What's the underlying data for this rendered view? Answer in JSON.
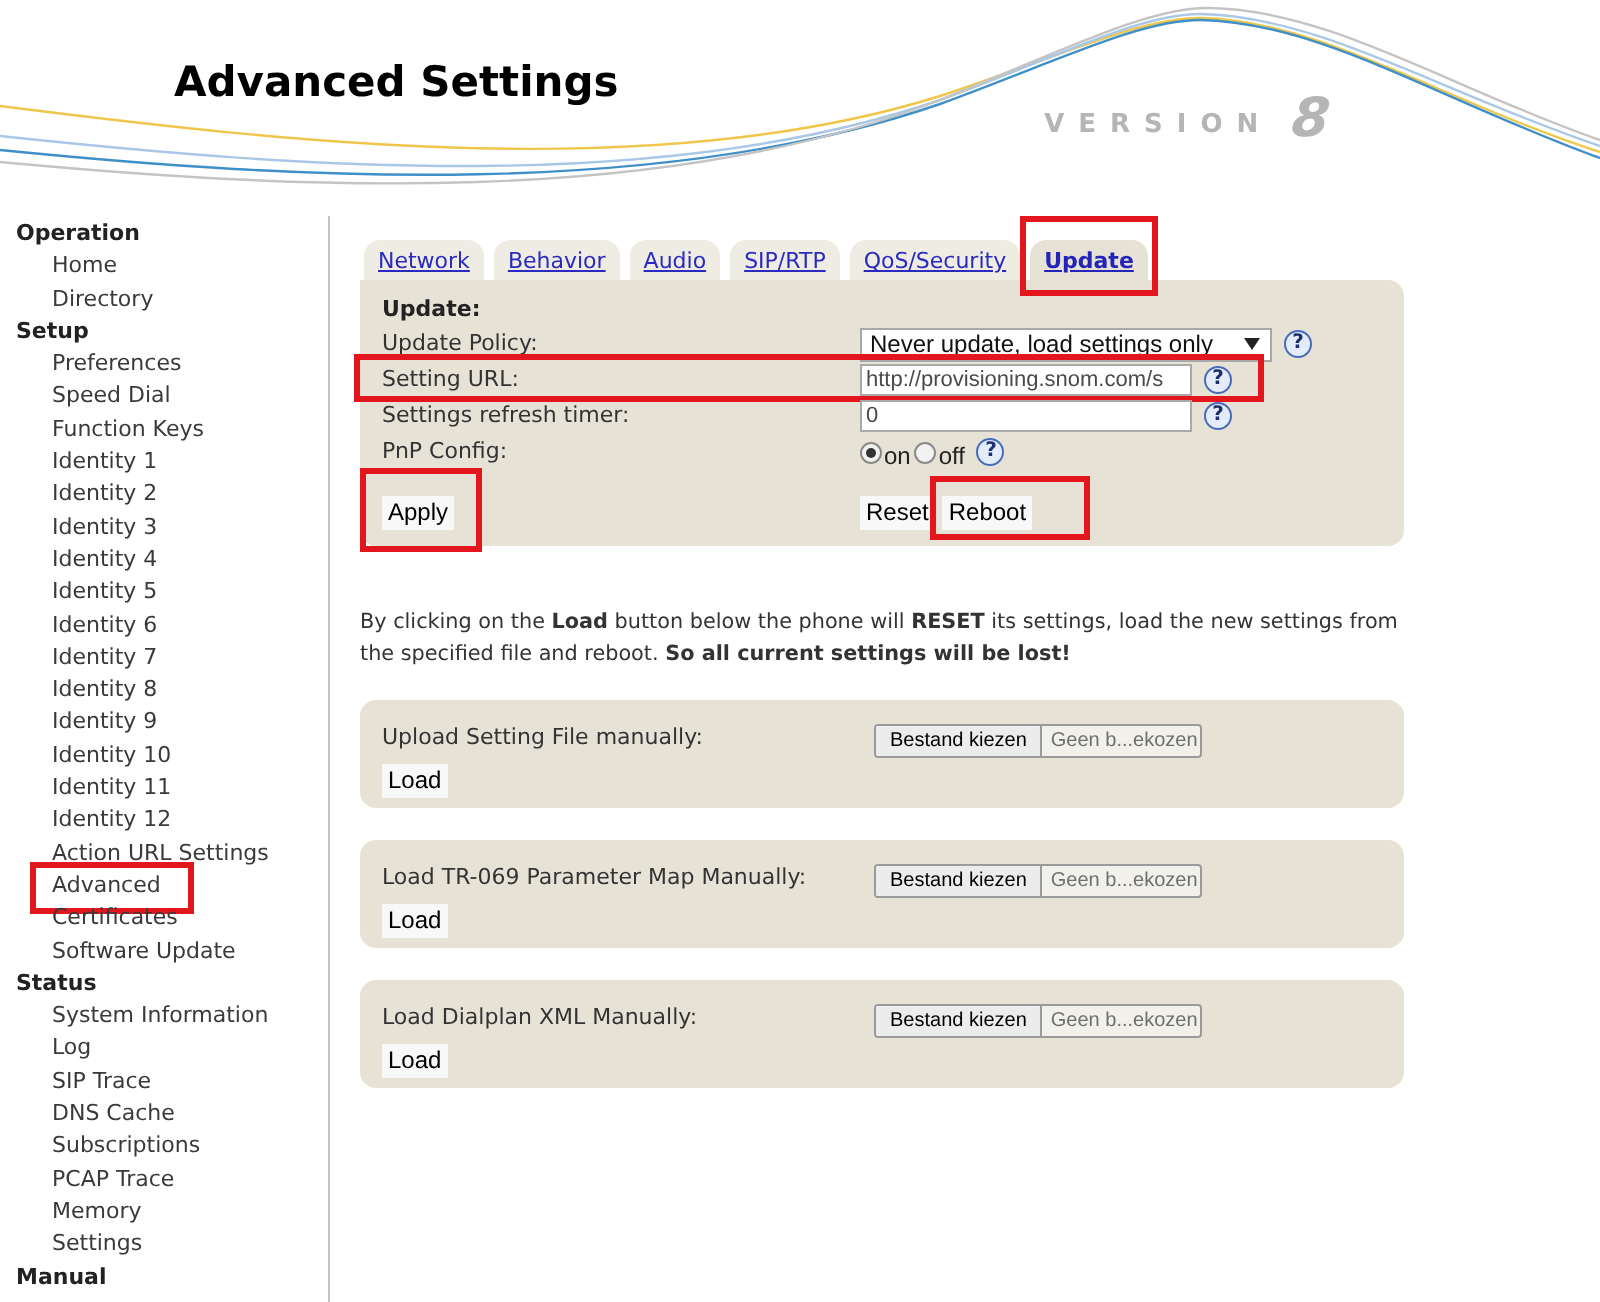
{
  "header": {
    "title": "Advanced Settings",
    "version_label": "VERSION",
    "version_number": "8"
  },
  "sidebar": {
    "sections": [
      {
        "title": "Operation",
        "items": [
          {
            "label": "Home",
            "highlighted": false
          },
          {
            "label": "Directory",
            "highlighted": false
          }
        ]
      },
      {
        "title": "Setup",
        "items": [
          {
            "label": "Preferences",
            "highlighted": false
          },
          {
            "label": "Speed Dial",
            "highlighted": false
          },
          {
            "label": "Function Keys",
            "highlighted": false
          },
          {
            "label": "Identity 1",
            "highlighted": false
          },
          {
            "label": "Identity 2",
            "highlighted": false
          },
          {
            "label": "Identity 3",
            "highlighted": false
          },
          {
            "label": "Identity 4",
            "highlighted": false
          },
          {
            "label": "Identity 5",
            "highlighted": false
          },
          {
            "label": "Identity 6",
            "highlighted": false
          },
          {
            "label": "Identity 7",
            "highlighted": false
          },
          {
            "label": "Identity 8",
            "highlighted": false
          },
          {
            "label": "Identity 9",
            "highlighted": false
          },
          {
            "label": "Identity 10",
            "highlighted": false
          },
          {
            "label": "Identity 11",
            "highlighted": false
          },
          {
            "label": "Identity 12",
            "highlighted": false
          },
          {
            "label": "Action URL Settings",
            "highlighted": false
          },
          {
            "label": "Advanced",
            "highlighted": true
          },
          {
            "label": "Certificates",
            "highlighted": false
          },
          {
            "label": "Software Update",
            "highlighted": false
          }
        ]
      },
      {
        "title": "Status",
        "items": [
          {
            "label": "System Information",
            "highlighted": false
          },
          {
            "label": "Log",
            "highlighted": false
          },
          {
            "label": "SIP Trace",
            "highlighted": false
          },
          {
            "label": "DNS Cache",
            "highlighted": false
          },
          {
            "label": "Subscriptions",
            "highlighted": false
          },
          {
            "label": "PCAP Trace",
            "highlighted": false
          },
          {
            "label": "Memory",
            "highlighted": false
          },
          {
            "label": "Settings",
            "highlighted": false
          }
        ]
      },
      {
        "title": "Manual"
      }
    ]
  },
  "tabs": [
    {
      "label": "Network",
      "selected": false,
      "highlighted": false
    },
    {
      "label": "Behavior",
      "selected": false,
      "highlighted": false
    },
    {
      "label": "Audio",
      "selected": false,
      "highlighted": false
    },
    {
      "label": "SIP/RTP",
      "selected": false,
      "highlighted": false
    },
    {
      "label": "QoS/Security",
      "selected": false,
      "highlighted": false
    },
    {
      "label": "Update",
      "selected": true,
      "highlighted": true
    }
  ],
  "update_panel": {
    "heading": "Update:",
    "rows": [
      {
        "kind": "select",
        "label": "Update Policy:",
        "value": "Never update, load settings only",
        "help": "?",
        "highlighted": false
      },
      {
        "kind": "text",
        "label": "Setting URL:",
        "value": "http://provisioning.snom.com/s",
        "help": "?",
        "highlighted": true
      },
      {
        "kind": "text",
        "label": "Settings refresh timer:",
        "value": "0",
        "help": "?",
        "highlighted": false
      },
      {
        "kind": "radio",
        "label": "PnP Config:",
        "options": [
          {
            "label": "on",
            "selected": true
          },
          {
            "label": "off",
            "selected": false
          }
        ],
        "help": "?",
        "highlighted": false
      }
    ],
    "left_buttons": [
      {
        "label": "Apply",
        "highlighted": true
      }
    ],
    "right_buttons": [
      {
        "label": "Reset",
        "highlighted": false
      },
      {
        "label": "Reboot",
        "highlighted": true
      }
    ]
  },
  "notice": "By clicking on the **Load** button below the phone will **RESET** its settings, load the new settings from the specified file and reboot. **So all current settings will be lost!**",
  "upload_panels": [
    {
      "label": "Upload Setting File manually:",
      "file_button": "Bestand kiezen",
      "file_status": "Geen b...ekozen",
      "button": "Load"
    },
    {
      "label": "Load TR-069 Parameter Map Manually:",
      "file_button": "Bestand kiezen",
      "file_status": "Geen b...ekozen",
      "button": "Load"
    },
    {
      "label": "Load Dialplan XML Manually:",
      "file_button": "Bestand kiezen",
      "file_status": "Geen b...ekozen",
      "button": "Load"
    }
  ]
}
